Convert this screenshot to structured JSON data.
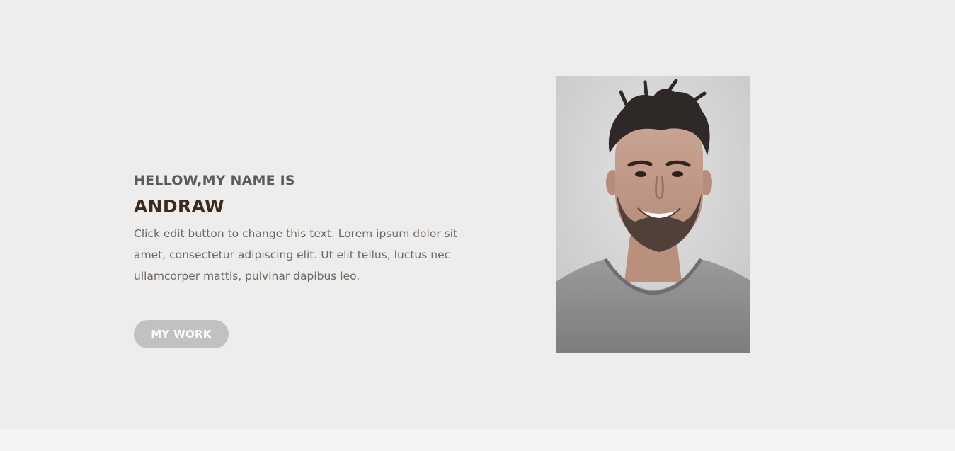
{
  "hero": {
    "greeting": "HELLOW,MY NAME IS",
    "name": "ANDRAW",
    "bio": "Click edit button to change this text. Lorem ipsum dolor sit amet, consectetur adipiscing elit. Ut elit tellus, luctus nec ullamcorper mattis, pulvinar dapibus leo.",
    "button_label": "MY WORK"
  },
  "portrait": {
    "subject": "smiling man with beard in grey t-shirt"
  },
  "colors": {
    "hero_background": "#efedeb",
    "greeting_text": "#5b5b5b",
    "name_text": "#3d2a1e",
    "body_text": "#6a6866",
    "button_background": "#c2c1c0",
    "button_text": "#ffffff",
    "footer_strip": "#f4f4f4"
  }
}
